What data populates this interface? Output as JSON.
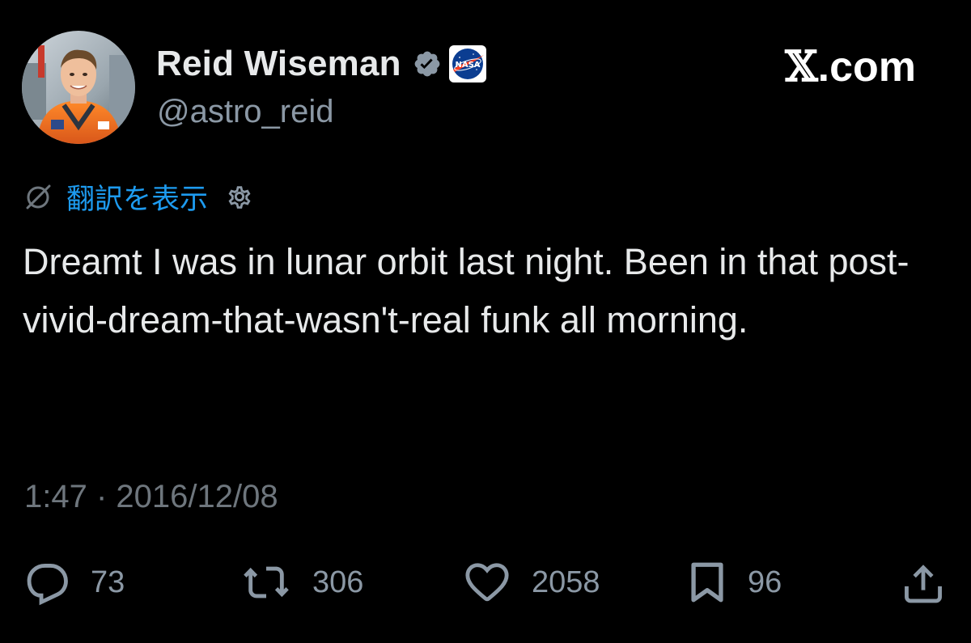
{
  "author": {
    "display_name": "Reid Wiseman",
    "handle": "@astro_reid",
    "affiliate_badge": "NASA",
    "verified": true
  },
  "watermark": {
    "x_letter": "𝕏",
    "domain": ".com"
  },
  "translate": {
    "label": "翻訳を表示"
  },
  "tweet": {
    "text": "Dreamt I was in lunar orbit last night. Been in that post-vivid-dream-that-wasn't-real funk all morning.",
    "timestamp": "1:47 · 2016/12/08"
  },
  "actions": {
    "replies": "73",
    "retweets": "306",
    "likes": "2058",
    "bookmarks": "96"
  },
  "icons": {
    "reply": "reply-icon",
    "retweet": "retweet-icon",
    "like": "heart-icon",
    "bookmark": "bookmark-icon",
    "share": "share-icon",
    "verified": "verified-badge-icon",
    "no_translate": "slashed-circle-icon",
    "settings": "gear-icon"
  },
  "colors": {
    "background": "#000000",
    "text": "#e7e9ea",
    "secondary": "#8b98a5",
    "link": "#1d9bf0",
    "verified": "#8b98a5",
    "nasa_blue": "#0b3d91",
    "nasa_red": "#fc3d21"
  }
}
